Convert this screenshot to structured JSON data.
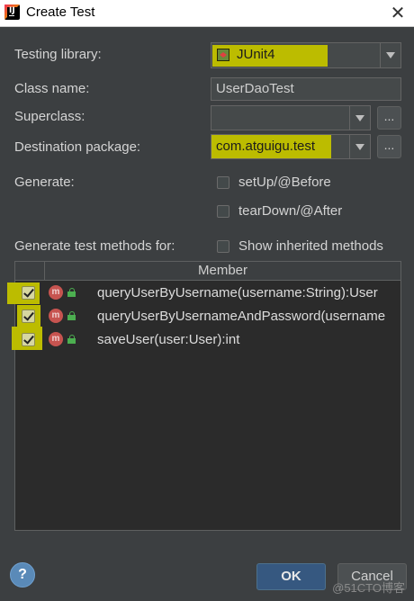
{
  "window": {
    "title": "Create Test",
    "close_glyph": "✕"
  },
  "form": {
    "testing_library_label": "Testing library:",
    "testing_library_value": "JUnit4",
    "class_name_label": "Class name:",
    "class_name_value": "UserDaoTest",
    "superclass_label": "Superclass:",
    "superclass_value": "",
    "destination_label": "Destination package:",
    "destination_value": "com.atguigu.test",
    "browse_label": "...",
    "generate_label": "Generate:",
    "setup_label": "setUp/@Before",
    "setup_checked": false,
    "teardown_label": "tearDown/@After",
    "teardown_checked": false,
    "methods_label": "Generate test methods for:",
    "show_inherited_label": "Show inherited methods",
    "show_inherited_checked": false
  },
  "table": {
    "header_member": "Member",
    "rows": [
      {
        "checked": true,
        "icon": "method-icon",
        "icon_letter": "m",
        "text": "queryUserByUsername(username:String):User"
      },
      {
        "checked": true,
        "icon": "method-icon",
        "icon_letter": "m",
        "text": "queryUserByUsernameAndPassword(username"
      },
      {
        "checked": true,
        "icon": "method-icon",
        "icon_letter": "m",
        "text": "saveUser(user:User):int"
      }
    ]
  },
  "buttons": {
    "help": "?",
    "ok": "OK",
    "cancel": "Cancel"
  },
  "watermark": "@51CTO博客",
  "colors": {
    "background": "#3c3f41",
    "highlight": "#bcbc00",
    "ok_button": "#365880"
  }
}
